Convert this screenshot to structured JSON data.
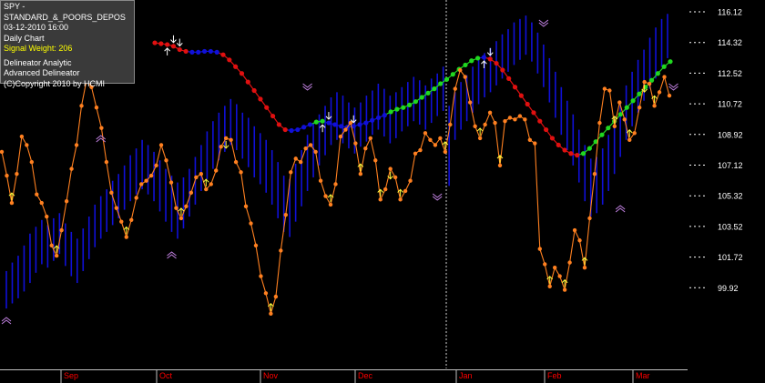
{
  "info_panel": {
    "symbol": "SPY - STANDARD_&_POORS_DEPOS",
    "datetime": "03-12-2010  16:00",
    "timeframe": "Daily Chart",
    "signal_weight": "Signal Weight: 206",
    "indicator_1": "Delineator Analytic",
    "indicator_2": "Advanced Delineator",
    "copyright": "(C)Copyright 2010 by HCMI"
  },
  "colors": {
    "background": "#000000",
    "price_bars": "#1010d8",
    "oscillator": "#ff8020",
    "delineator_up": "#20d820",
    "delineator_down": "#e01010",
    "delineator_neutral": "#1010d8",
    "axis_labels": "#ffffff",
    "month_labels": "#ff0000",
    "arrows_up": "#ffff40",
    "arrows_white": "#ffffff",
    "chevrons": "#c080e0"
  },
  "chart_data": {
    "type": "line",
    "title": "",
    "xlabel": "",
    "ylabel": "",
    "ylim": [
      98.2,
      116.6
    ],
    "y_ticks": [
      "116.12",
      "114.32",
      "112.52",
      "110.72",
      "108.92",
      "107.12",
      "105.32",
      "103.52",
      "101.72",
      "99.92"
    ],
    "x_month_labels": [
      "Sep",
      "Oct",
      "Nov",
      "Dec",
      "Jan",
      "Feb",
      "Mar"
    ],
    "grid": false,
    "series": [
      {
        "name": "",
        "kind": "price_bars",
        "values": [
          [
            98.7,
            100.9
          ],
          [
            99.0,
            101.4
          ],
          [
            99.3,
            101.8
          ],
          [
            99.7,
            102.4
          ],
          [
            100.2,
            103.1
          ],
          [
            100.8,
            103.5
          ],
          [
            101.3,
            103.9
          ],
          [
            101.1,
            103.6
          ],
          [
            101.5,
            104.0
          ],
          [
            101.9,
            104.3
          ],
          [
            101.2,
            103.7
          ],
          [
            100.6,
            103.2
          ],
          [
            100.2,
            102.8
          ],
          [
            100.9,
            103.4
          ],
          [
            101.6,
            104.1
          ],
          [
            102.3,
            104.8
          ],
          [
            102.8,
            105.3
          ],
          [
            103.2,
            105.7
          ],
          [
            103.6,
            106.2
          ],
          [
            104.0,
            106.6
          ],
          [
            104.5,
            107.1
          ],
          [
            105.0,
            107.7
          ],
          [
            105.4,
            108.1
          ],
          [
            105.7,
            108.6
          ],
          [
            105.4,
            108.3
          ],
          [
            105.0,
            107.9
          ],
          [
            104.4,
            107.4
          ],
          [
            103.8,
            106.9
          ],
          [
            103.2,
            106.5
          ],
          [
            102.8,
            106.1
          ],
          [
            103.4,
            106.4
          ],
          [
            104.1,
            106.9
          ],
          [
            104.8,
            107.6
          ],
          [
            105.6,
            108.3
          ],
          [
            106.3,
            109.1
          ],
          [
            106.9,
            109.7
          ],
          [
            107.4,
            110.2
          ],
          [
            107.9,
            110.6
          ],
          [
            108.3,
            111.0
          ],
          [
            108.0,
            110.7
          ],
          [
            107.5,
            110.2
          ],
          [
            107.0,
            109.9
          ],
          [
            106.4,
            109.4
          ],
          [
            106.0,
            109.0
          ],
          [
            105.5,
            108.6
          ],
          [
            104.8,
            108.0
          ],
          [
            104.0,
            107.3
          ],
          [
            103.2,
            106.5
          ],
          [
            102.9,
            106.3
          ],
          [
            103.8,
            107.2
          ],
          [
            104.7,
            108.0
          ],
          [
            105.6,
            108.9
          ],
          [
            106.4,
            109.6
          ],
          [
            107.1,
            110.1
          ],
          [
            107.7,
            110.6
          ],
          [
            108.3,
            111.1
          ],
          [
            108.6,
            111.4
          ],
          [
            108.4,
            111.2
          ],
          [
            108.1,
            110.8
          ],
          [
            107.8,
            110.5
          ],
          [
            108.2,
            110.8
          ],
          [
            108.5,
            111.2
          ],
          [
            108.9,
            111.5
          ],
          [
            109.2,
            111.9
          ],
          [
            108.8,
            111.6
          ],
          [
            108.4,
            111.2
          ],
          [
            108.7,
            111.4
          ],
          [
            109.1,
            111.7
          ],
          [
            109.4,
            112.0
          ],
          [
            109.7,
            112.3
          ],
          [
            109.5,
            112.1
          ],
          [
            109.2,
            111.8
          ],
          [
            109.6,
            112.2
          ],
          [
            110.0,
            112.5
          ],
          [
            110.3,
            112.9
          ],
          [
            105.9,
            110.6
          ],
          [
            108.6,
            111.4
          ],
          [
            109.2,
            112.0
          ],
          [
            109.7,
            112.4
          ],
          [
            110.2,
            112.9
          ],
          [
            110.7,
            113.3
          ],
          [
            111.1,
            113.7
          ],
          [
            111.4,
            114.0
          ],
          [
            111.8,
            114.4
          ],
          [
            112.2,
            114.8
          ],
          [
            112.6,
            115.1
          ],
          [
            113.0,
            115.5
          ],
          [
            113.3,
            115.7
          ],
          [
            113.6,
            115.9
          ],
          [
            113.2,
            115.5
          ],
          [
            112.5,
            114.9
          ],
          [
            111.7,
            114.2
          ],
          [
            110.8,
            113.4
          ],
          [
            109.9,
            112.6
          ],
          [
            108.9,
            111.7
          ],
          [
            108.0,
            110.9
          ],
          [
            107.1,
            110.1
          ],
          [
            106.1,
            109.2
          ],
          [
            105.0,
            108.3
          ],
          [
            104.1,
            107.5
          ],
          [
            104.3,
            107.6
          ],
          [
            104.8,
            108.1
          ],
          [
            105.6,
            108.9
          ],
          [
            106.6,
            109.9
          ],
          [
            107.6,
            110.9
          ],
          [
            108.6,
            111.8
          ],
          [
            109.4,
            112.6
          ],
          [
            110.2,
            113.3
          ],
          [
            110.9,
            113.9
          ],
          [
            111.6,
            114.6
          ],
          [
            112.2,
            115.2
          ],
          [
            112.9,
            115.7
          ],
          [
            113.4,
            116.0
          ]
        ]
      },
      {
        "name": "",
        "kind": "delineator",
        "values": [
          [
            34,
            null,
            null
          ],
          [
            35,
            null,
            null
          ],
          [
            36,
            null,
            null
          ],
          [
            37,
            null,
            null
          ],
          [
            38,
            null,
            null
          ],
          [
            39,
            114.3,
            "down"
          ],
          [
            40,
            114.25,
            "down"
          ],
          [
            41,
            114.2,
            "down"
          ],
          [
            42,
            114.1,
            "down"
          ],
          [
            43,
            113.9,
            "down"
          ],
          [
            44,
            113.8,
            "down"
          ],
          [
            45,
            113.75,
            "neutral"
          ],
          [
            46,
            113.75,
            "neutral"
          ],
          [
            47,
            113.8,
            "neutral"
          ],
          [
            48,
            113.8,
            "neutral"
          ],
          [
            49,
            113.75,
            "neutral"
          ],
          [
            50,
            113.6,
            "down"
          ],
          [
            51,
            113.3,
            "down"
          ],
          [
            52,
            112.9,
            "down"
          ],
          [
            53,
            112.5,
            "down"
          ],
          [
            54,
            112.0,
            "down"
          ],
          [
            55,
            111.5,
            "down"
          ],
          [
            56,
            111.0,
            "down"
          ],
          [
            57,
            110.5,
            "down"
          ],
          [
            58,
            110.0,
            "down"
          ],
          [
            59,
            109.5,
            "down"
          ],
          [
            60,
            109.2,
            "down"
          ],
          [
            61,
            109.15,
            "neutral"
          ],
          [
            62,
            109.2,
            "neutral"
          ],
          [
            63,
            109.35,
            "neutral"
          ],
          [
            64,
            109.5,
            "neutral"
          ],
          [
            65,
            109.65,
            "up"
          ],
          [
            66,
            109.7,
            "up"
          ],
          [
            67,
            109.6,
            "neutral"
          ],
          [
            68,
            109.5,
            "neutral"
          ],
          [
            69,
            109.4,
            "neutral"
          ],
          [
            70,
            109.35,
            "neutral"
          ],
          [
            71,
            109.4,
            "neutral"
          ],
          [
            72,
            109.5,
            "neutral"
          ],
          [
            73,
            109.6,
            "neutral"
          ],
          [
            74,
            109.75,
            "neutral"
          ],
          [
            75,
            109.9,
            "neutral"
          ],
          [
            76,
            110.05,
            "neutral"
          ],
          [
            77,
            110.25,
            "up"
          ],
          [
            78,
            110.4,
            "up"
          ],
          [
            79,
            110.5,
            "up"
          ],
          [
            80,
            110.65,
            "up"
          ],
          [
            81,
            110.85,
            "up"
          ],
          [
            82,
            111.1,
            "up"
          ],
          [
            83,
            111.35,
            "up"
          ],
          [
            84,
            111.6,
            "up"
          ],
          [
            85,
            111.9,
            "up"
          ],
          [
            86,
            112.15,
            "up"
          ],
          [
            87,
            112.45,
            "up"
          ],
          [
            88,
            112.75,
            "up"
          ],
          [
            89,
            113.0,
            "up"
          ],
          [
            90,
            113.25,
            "up"
          ],
          [
            91,
            113.4,
            "up"
          ],
          [
            92,
            113.45,
            "neutral"
          ],
          [
            93,
            113.35,
            "down"
          ],
          [
            94,
            113.1,
            "down"
          ],
          [
            95,
            112.7,
            "down"
          ],
          [
            96,
            112.2,
            "down"
          ],
          [
            97,
            111.7,
            "down"
          ],
          [
            98,
            111.2,
            "down"
          ],
          [
            99,
            110.7,
            "down"
          ],
          [
            100,
            110.2,
            "down"
          ],
          [
            101,
            109.7,
            "down"
          ],
          [
            102,
            109.2,
            "down"
          ],
          [
            103,
            108.7,
            "down"
          ],
          [
            104,
            108.3,
            "down"
          ],
          [
            105,
            108.0,
            "down"
          ],
          [
            106,
            107.8,
            "down"
          ],
          [
            107,
            107.7,
            "down"
          ],
          [
            108,
            107.8,
            "up"
          ],
          [
            109,
            108.1,
            "up"
          ],
          [
            110,
            108.5,
            "up"
          ],
          [
            111,
            108.9,
            "up"
          ],
          [
            112,
            109.3,
            "up"
          ],
          [
            113,
            109.7,
            "up"
          ],
          [
            114,
            110.1,
            "up"
          ],
          [
            115,
            110.5,
            "up"
          ],
          [
            116,
            110.9,
            "up"
          ],
          [
            117,
            111.3,
            "up"
          ],
          [
            118,
            111.7,
            "up"
          ],
          [
            119,
            112.1,
            "up"
          ],
          [
            120,
            112.5,
            "up"
          ],
          [
            121,
            112.9,
            "up"
          ],
          [
            122,
            113.2,
            "up"
          ]
        ]
      },
      {
        "name": "",
        "kind": "oscillator",
        "values": [
          107.9,
          106.5,
          104.9,
          106.6,
          108.8,
          108.3,
          107.3,
          105.4,
          104.9,
          104.1,
          102.4,
          101.8,
          103.3,
          105.0,
          106.9,
          108.3,
          110.6,
          112.1,
          111.7,
          110.5,
          109.3,
          107.3,
          105.5,
          104.6,
          103.8,
          102.9,
          103.9,
          105.2,
          106.0,
          106.2,
          106.5,
          107.1,
          108.3,
          107.4,
          106.1,
          104.6,
          104.0,
          104.7,
          105.5,
          106.4,
          106.6,
          105.7,
          106.0,
          106.8,
          108.2,
          108.7,
          108.6,
          107.3,
          106.7,
          104.7,
          103.7,
          102.4,
          100.6,
          99.6,
          98.4,
          99.4,
          102.1,
          104.2,
          106.7,
          107.5,
          107.3,
          108.1,
          108.3,
          107.9,
          106.2,
          105.3,
          104.8,
          106.0,
          108.8,
          109.2,
          109.6,
          108.4,
          106.6,
          108.1,
          108.7,
          107.4,
          105.1,
          105.7,
          106.9,
          106.4,
          105.1,
          105.6,
          106.2,
          107.8,
          108.0,
          109.0,
          108.6,
          108.3,
          108.7,
          107.9,
          109.5,
          111.6,
          112.7,
          112.3,
          110.8,
          109.4,
          108.7,
          109.5,
          110.2,
          109.6,
          107.1,
          109.7,
          109.9,
          109.8,
          110.0,
          109.8,
          108.6,
          108.4,
          102.2,
          101.3,
          100.0,
          101.1,
          100.6,
          99.8,
          101.4,
          103.3,
          102.7,
          101.1,
          104.0,
          106.6,
          109.6,
          111.6,
          111.5,
          109.4,
          110.8,
          109.8,
          108.6,
          109.0,
          110.5,
          112.0,
          111.9,
          110.6,
          111.4,
          112.3,
          111.2
        ]
      }
    ]
  }
}
